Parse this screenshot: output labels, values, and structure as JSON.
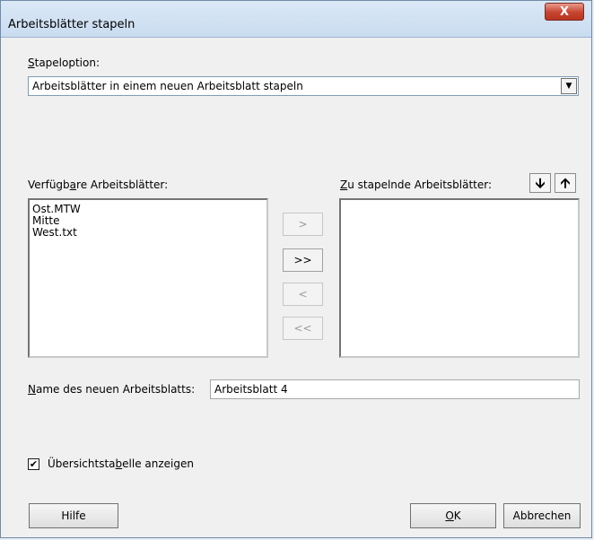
{
  "window": {
    "title": "Arbeitsblätter stapeln",
    "close_glyph": "X"
  },
  "stack_option": {
    "label_first": "S",
    "label_rest": "tapeloption:",
    "selected_value": "Arbeitsblätter in einem neuen Arbeitsblatt stapeln",
    "arrow_glyph": "▼"
  },
  "available": {
    "label_pre": "Verfügb",
    "label_u": "a",
    "label_post": "re Arbeitsblätter:",
    "items": [
      "Ost.MTW",
      "Mitte",
      "West.txt"
    ]
  },
  "to_stack": {
    "label_u": "Z",
    "label_post": "u stapelnde Arbeitsblätter:",
    "down_glyph": "🡫",
    "up_glyph": "🡩"
  },
  "move_buttons": {
    "add_one": ">",
    "add_all": ">>",
    "remove_one": "<",
    "remove_all": "<<"
  },
  "new_sheet": {
    "label_u": "N",
    "label_post": "ame des neuen Arbeitsblatts:",
    "value": "Arbeitsblatt 4"
  },
  "summary": {
    "label_pre": "Übersichtsta",
    "label_u": "b",
    "label_post": "elle anzeigen",
    "checked_glyph": "✔"
  },
  "buttons": {
    "help": "Hilfe",
    "ok_u": "O",
    "ok_post": "K",
    "cancel": "Abbrechen"
  },
  "colors": {
    "close_button": "#c7442f",
    "title_bar": "#dbe8f6"
  }
}
